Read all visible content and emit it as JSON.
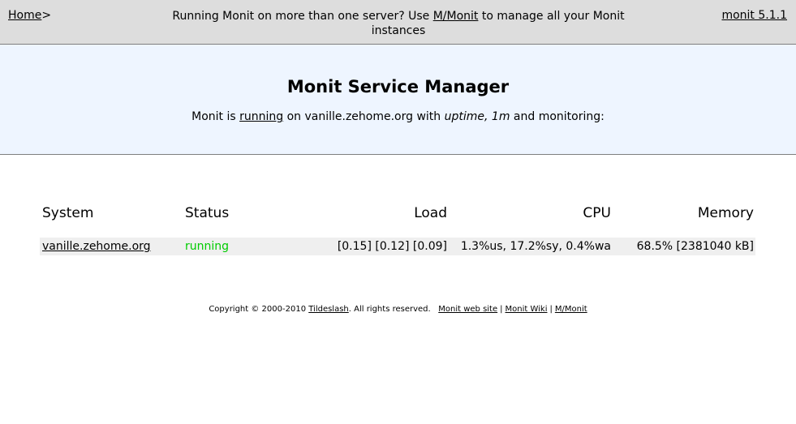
{
  "topbar": {
    "home_label": "Home",
    "home_suffix": ">",
    "message_prefix": "Running Monit on more than one server? Use ",
    "message_link": "M/Monit",
    "message_suffix": " to manage all your Monit instances",
    "version_label": "monit 5.1.1"
  },
  "header": {
    "title": "Monit Service Manager",
    "sub_prefix": "Monit is ",
    "sub_running": "running",
    "sub_host": " on vanille.zehome.org with ",
    "sub_uptime_label": "uptime, 1m",
    "sub_suffix": " and monitoring:"
  },
  "table": {
    "columns": [
      "System",
      "Status",
      "Load",
      "CPU",
      "Memory"
    ],
    "rows": [
      {
        "system": "vanille.zehome.org",
        "status": "running",
        "load": "[0.15] [0.12] [0.09]",
        "cpu": "1.3%us, 17.2%sy, 0.4%wa",
        "memory": "68.5% [2381040 kB]"
      }
    ]
  },
  "footer": {
    "copyright_prefix": "Copyright © 2000-2010 ",
    "company_link": "Tildeslash",
    "rights": ". All rights reserved.",
    "link_website": "Monit web site",
    "link_wiki": "Monit Wiki",
    "link_mmonit": "M/Monit",
    "separator": "|"
  },
  "colors": {
    "topbar_bg": "#dddddd",
    "header_bg": "#eef5ff",
    "row_bg": "#efefef",
    "status_running": "#00cc00"
  }
}
